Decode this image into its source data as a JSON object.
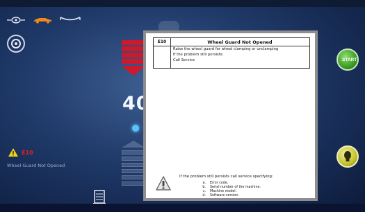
{
  "status": {
    "warning_code": "E10",
    "warning_message": "Wheel Guard Not Opened"
  },
  "display": {
    "value": "40"
  },
  "buttons": {
    "start_label": "START"
  },
  "dialog": {
    "code": "E10",
    "title": "Wheel Guard Not Opened",
    "lines": [
      "Raise the wheel guard for wheel clamping or unclamping",
      "If the problem still persists:",
      "Call Service"
    ],
    "footer_title": "If the problem still persists call service specifying:",
    "footer_items": [
      {
        "mark": "a.",
        "text": "Error code."
      },
      {
        "mark": "b.",
        "text": "Serial number of the machine."
      },
      {
        "mark": "c.",
        "text": "Machine model."
      },
      {
        "mark": "d.",
        "text": "Software version."
      }
    ]
  },
  "colors": {
    "accent_red": "#d0182a",
    "start_green": "#3d9b26",
    "light_yellow": "#c4c22b"
  }
}
